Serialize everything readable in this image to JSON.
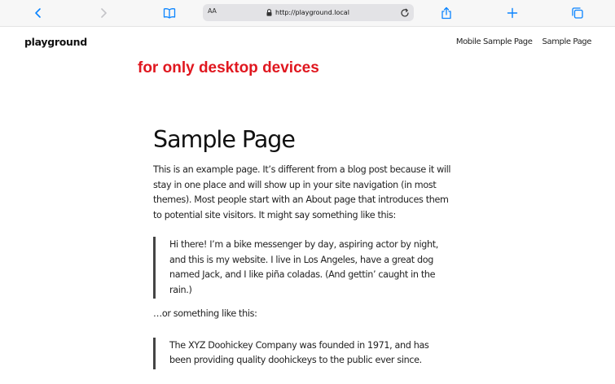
{
  "browser": {
    "text_size_label": "AA",
    "url": "http://playground.local",
    "icons": [
      "back-icon",
      "forward-icon",
      "bookmarks-icon",
      "lock-icon",
      "reload-icon",
      "share-icon",
      "new-tab-icon",
      "tabs-icon"
    ],
    "accent_color": "#0a84ff"
  },
  "site": {
    "title": "playground",
    "nav": [
      {
        "label": "Mobile Sample Page"
      },
      {
        "label": "Sample Page"
      }
    ],
    "notice": "for only desktop devices",
    "notice_color": "#e0171f"
  },
  "page": {
    "title": "Sample Page",
    "intro": "This is an example page. It’s different from a blog post because it will stay in one place and will show up in your site navigation (in most themes). Most people start with an About page that introduces them to potential site visitors. It might say something like this:",
    "quote1": "Hi there! I’m a bike messenger by day, aspiring actor by night, and this is my website. I live in Los Angeles, have a great dog named Jack, and I like piña coladas. (And gettin’ caught in the rain.)",
    "transition": "…or something like this:",
    "quote2": "The XYZ Doohickey Company was founded in 1971, and has been providing quality doohickeys to the public ever since."
  }
}
